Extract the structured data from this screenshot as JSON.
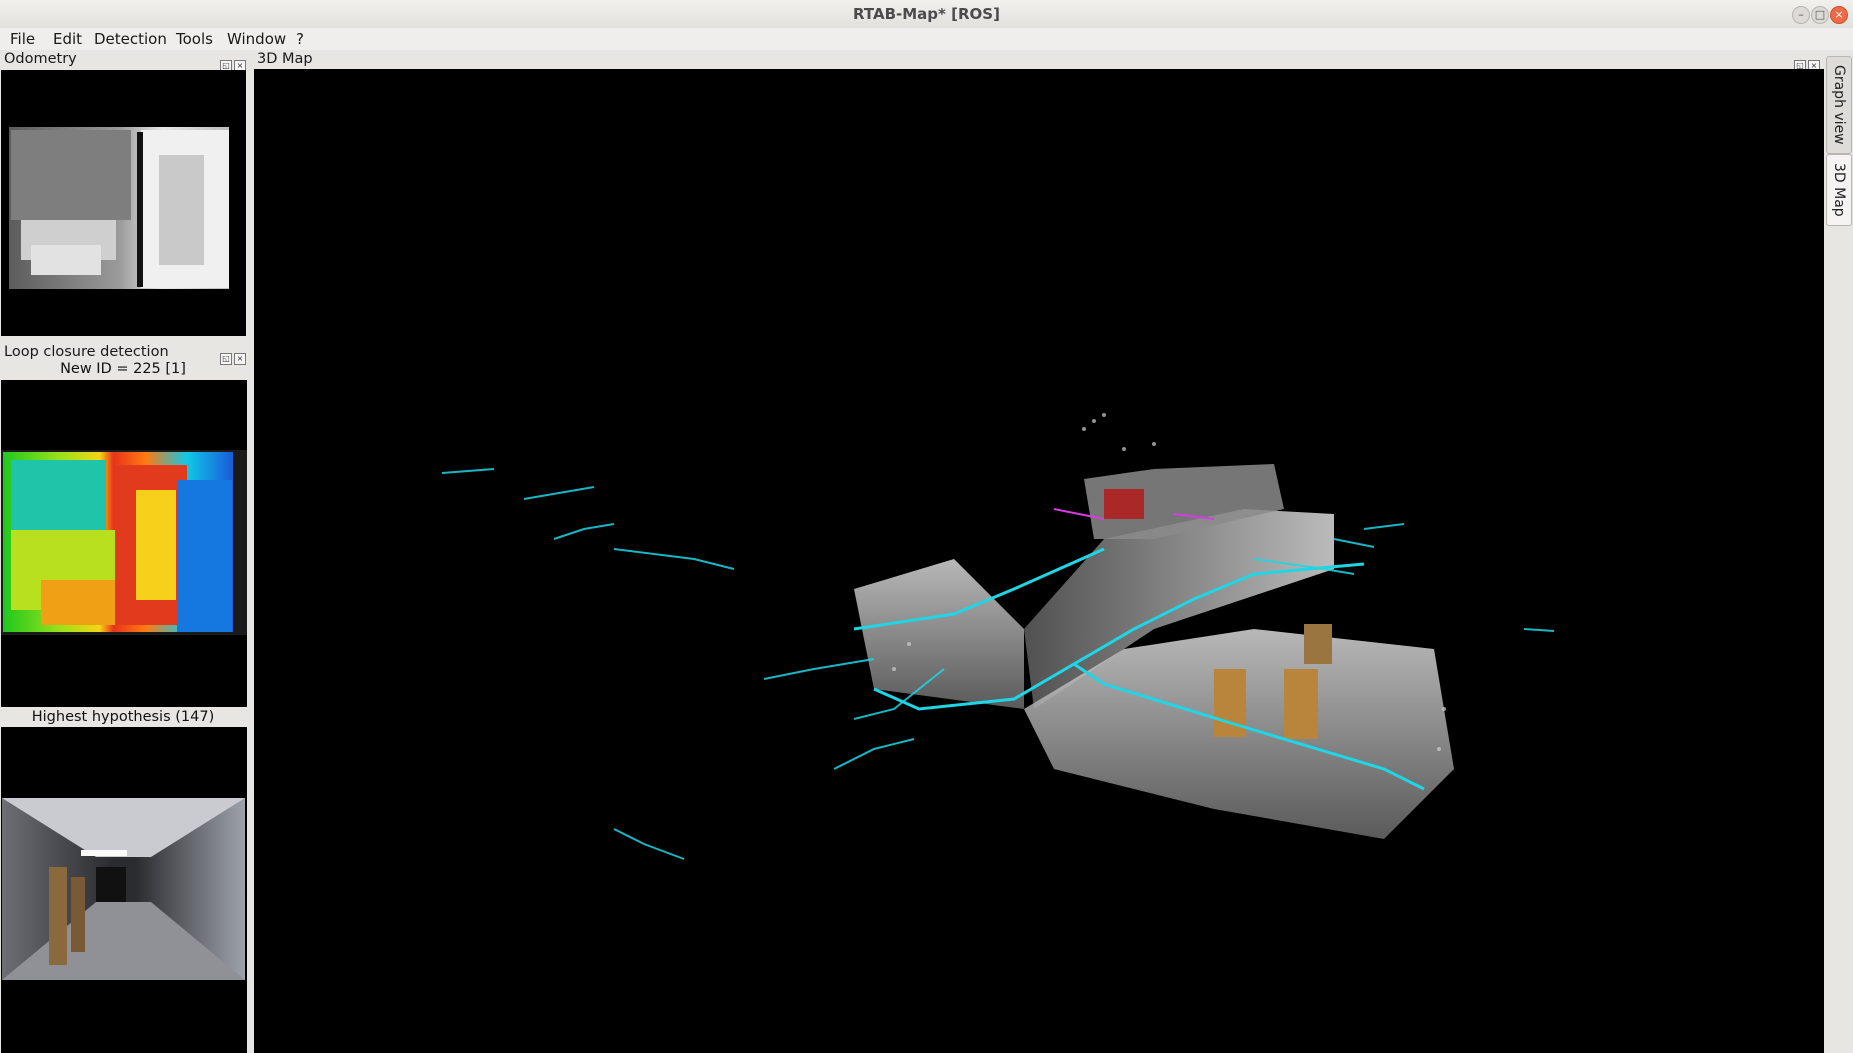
{
  "window": {
    "title": "RTAB-Map* [ROS]",
    "controls": [
      "minimize-icon",
      "maximize-icon",
      "close-icon"
    ]
  },
  "menubar": {
    "items": [
      "File",
      "Edit",
      "Detection",
      "Tools",
      "Window",
      "?"
    ]
  },
  "odometry": {
    "title": "Odometry"
  },
  "loop_closure": {
    "title": "Loop closure detection",
    "new_id_label": "New ID = 225 [1]",
    "hypothesis_label": "Highest hypothesis (147)"
  },
  "map3d": {
    "title": "3D Map"
  },
  "side_tabs": [
    "Graph view",
    "3D Map"
  ],
  "colors": {
    "trajectory": "#1fd6e6",
    "background": "#000000"
  }
}
